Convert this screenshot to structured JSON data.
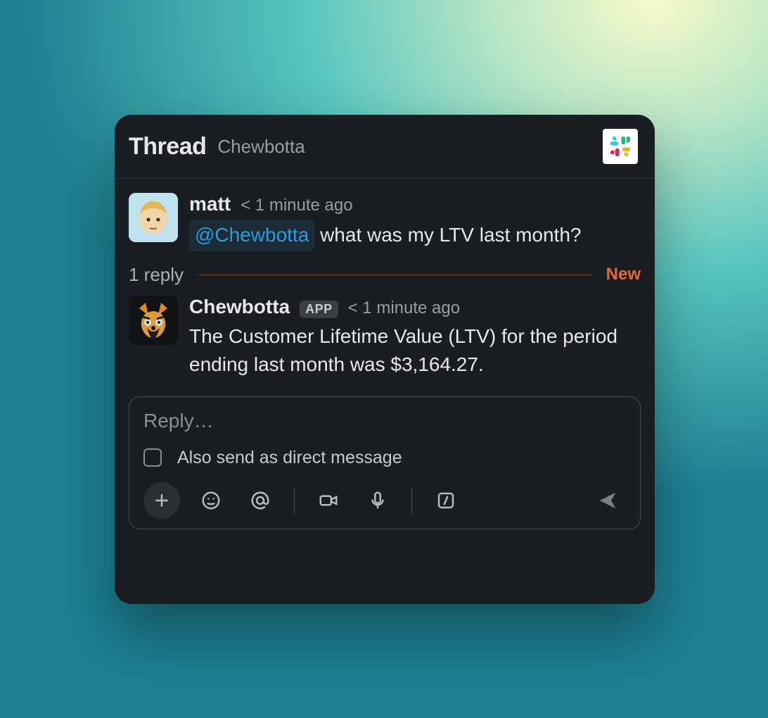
{
  "header": {
    "title": "Thread",
    "subtitle": "Chewbotta"
  },
  "messages": [
    {
      "author": "matt",
      "timestamp": "< 1 minute ago",
      "mention": "@Chewbotta",
      "text_after_mention": " what was my LTV last month?"
    },
    {
      "author": "Chewbotta",
      "app_badge": "APP",
      "timestamp": "< 1 minute ago",
      "text": "The Customer Lifetime Value (LTV) for the period ending last month was $3,164.27."
    }
  ],
  "separator": {
    "reply_count": "1 reply",
    "new_label": "New"
  },
  "composer": {
    "placeholder": "Reply…",
    "dm_label": "Also send as direct message"
  }
}
